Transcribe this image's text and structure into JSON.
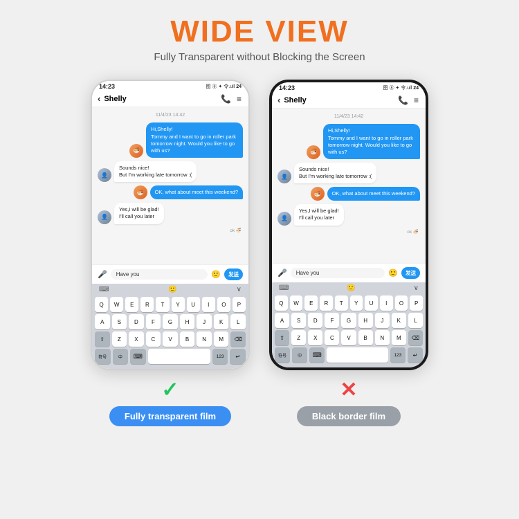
{
  "header": {
    "title": "WIDE VIEW",
    "subtitle": "Fully Transparent without Blocking the Screen"
  },
  "phones": [
    {
      "id": "phone-left",
      "frame": "white",
      "status": {
        "time": "14:23",
        "icons": "图 ⑧ ✦ 令.ull 24"
      },
      "chat": {
        "contact": "Shelly",
        "date": "11/4/23 14:42",
        "messages": [
          {
            "side": "sent",
            "text": "Hi,Shelly!\nTommy and I want to go in roller park tomorrow night. Would you like to go with us?",
            "avatar": "food"
          },
          {
            "side": "received",
            "text": "Sounds nice!\nBut I'm working late tomorrow :(",
            "avatar": "person"
          },
          {
            "side": "sent",
            "text": "OK, what about meet this weekend?",
            "avatar": "food"
          },
          {
            "side": "received",
            "text": "Yes,I will be glad!\nI'll call you later",
            "avatar": "person"
          }
        ],
        "status": "ok",
        "input_text": "Have you"
      },
      "label": {
        "type": "check",
        "symbol": "✓",
        "color": "green",
        "badge": "Fully transparent film",
        "badge_color": "blue"
      }
    },
    {
      "id": "phone-right",
      "frame": "black",
      "status": {
        "time": "14:23",
        "icons": "图 ⑧ ✦ 令.ull 24"
      },
      "chat": {
        "contact": "Shelly",
        "date": "11/4/23 14:42",
        "messages": [
          {
            "side": "sent",
            "text": "Hi,Shelly!\nTommy and I want to go in roller park tomorrow night. Would you like to go with us?",
            "avatar": "food"
          },
          {
            "side": "received",
            "text": "Sounds nice!\nBut I'm working late tomorrow :(",
            "avatar": "person"
          },
          {
            "side": "sent",
            "text": "OK, what about meet this weekend?",
            "avatar": "food"
          },
          {
            "side": "received",
            "text": "Yes,I will be glad!\nI'll call you later",
            "avatar": "person"
          }
        ],
        "status": "ok",
        "input_text": "Have you"
      },
      "label": {
        "type": "cross",
        "symbol": "✕",
        "color": "red",
        "badge": "Black border film",
        "badge_color": "gray"
      }
    }
  ],
  "keyboard": {
    "rows": [
      [
        "Q",
        "W",
        "E",
        "R",
        "T",
        "Y",
        "U",
        "I",
        "O",
        "P"
      ],
      [
        "A",
        "S",
        "D",
        "F",
        "G",
        "H",
        "J",
        "K",
        "L"
      ],
      [
        "⇧",
        "Z",
        "X",
        "C",
        "V",
        "B",
        "N",
        "M",
        "⌫"
      ],
      [
        "符号",
        "中",
        "⌨",
        "",
        "123",
        "↵"
      ]
    ]
  }
}
